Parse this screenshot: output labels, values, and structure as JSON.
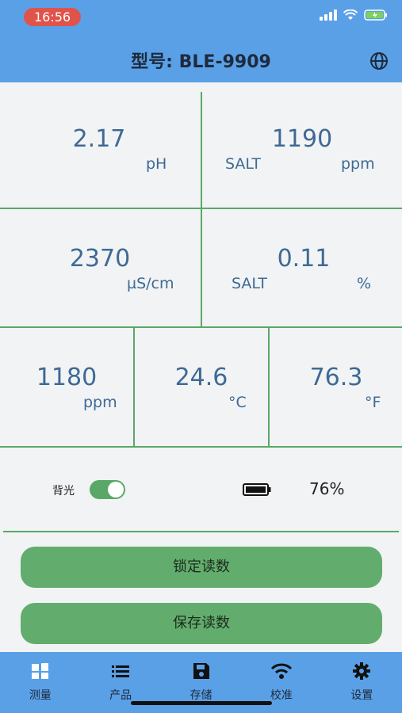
{
  "status_bar": {
    "time": "16:56"
  },
  "header": {
    "title": "型号: BLE-9909",
    "globe_icon": "globe-icon"
  },
  "readings": {
    "ph": {
      "value": "2.17",
      "unit": "pH"
    },
    "salt_ppm": {
      "value": "1190",
      "label": "SALT",
      "unit": "ppm"
    },
    "ec": {
      "value": "2370",
      "unit": "µS/cm"
    },
    "salt_pct": {
      "value": "0.11",
      "label": "SALT",
      "unit": "%"
    },
    "tds": {
      "value": "1180",
      "unit": "ppm"
    },
    "temp_c": {
      "value": "24.6",
      "unit": "°C"
    },
    "temp_f": {
      "value": "76.3",
      "unit": "°F"
    }
  },
  "controls": {
    "backlight_label": "背光",
    "backlight_on": true,
    "battery_percent": "76%"
  },
  "buttons": {
    "lock": "锁定读数",
    "save": "保存读数"
  },
  "nav": [
    {
      "label": "测量",
      "icon": "measure-icon"
    },
    {
      "label": "产品",
      "icon": "list-icon"
    },
    {
      "label": "存储",
      "icon": "save-icon"
    },
    {
      "label": "校准",
      "icon": "calibrate-icon"
    },
    {
      "label": "设置",
      "icon": "gear-icon"
    }
  ],
  "colors": {
    "header": "#5aa0e6",
    "accent_green": "#5aa867",
    "value_text": "#3e6a93"
  }
}
